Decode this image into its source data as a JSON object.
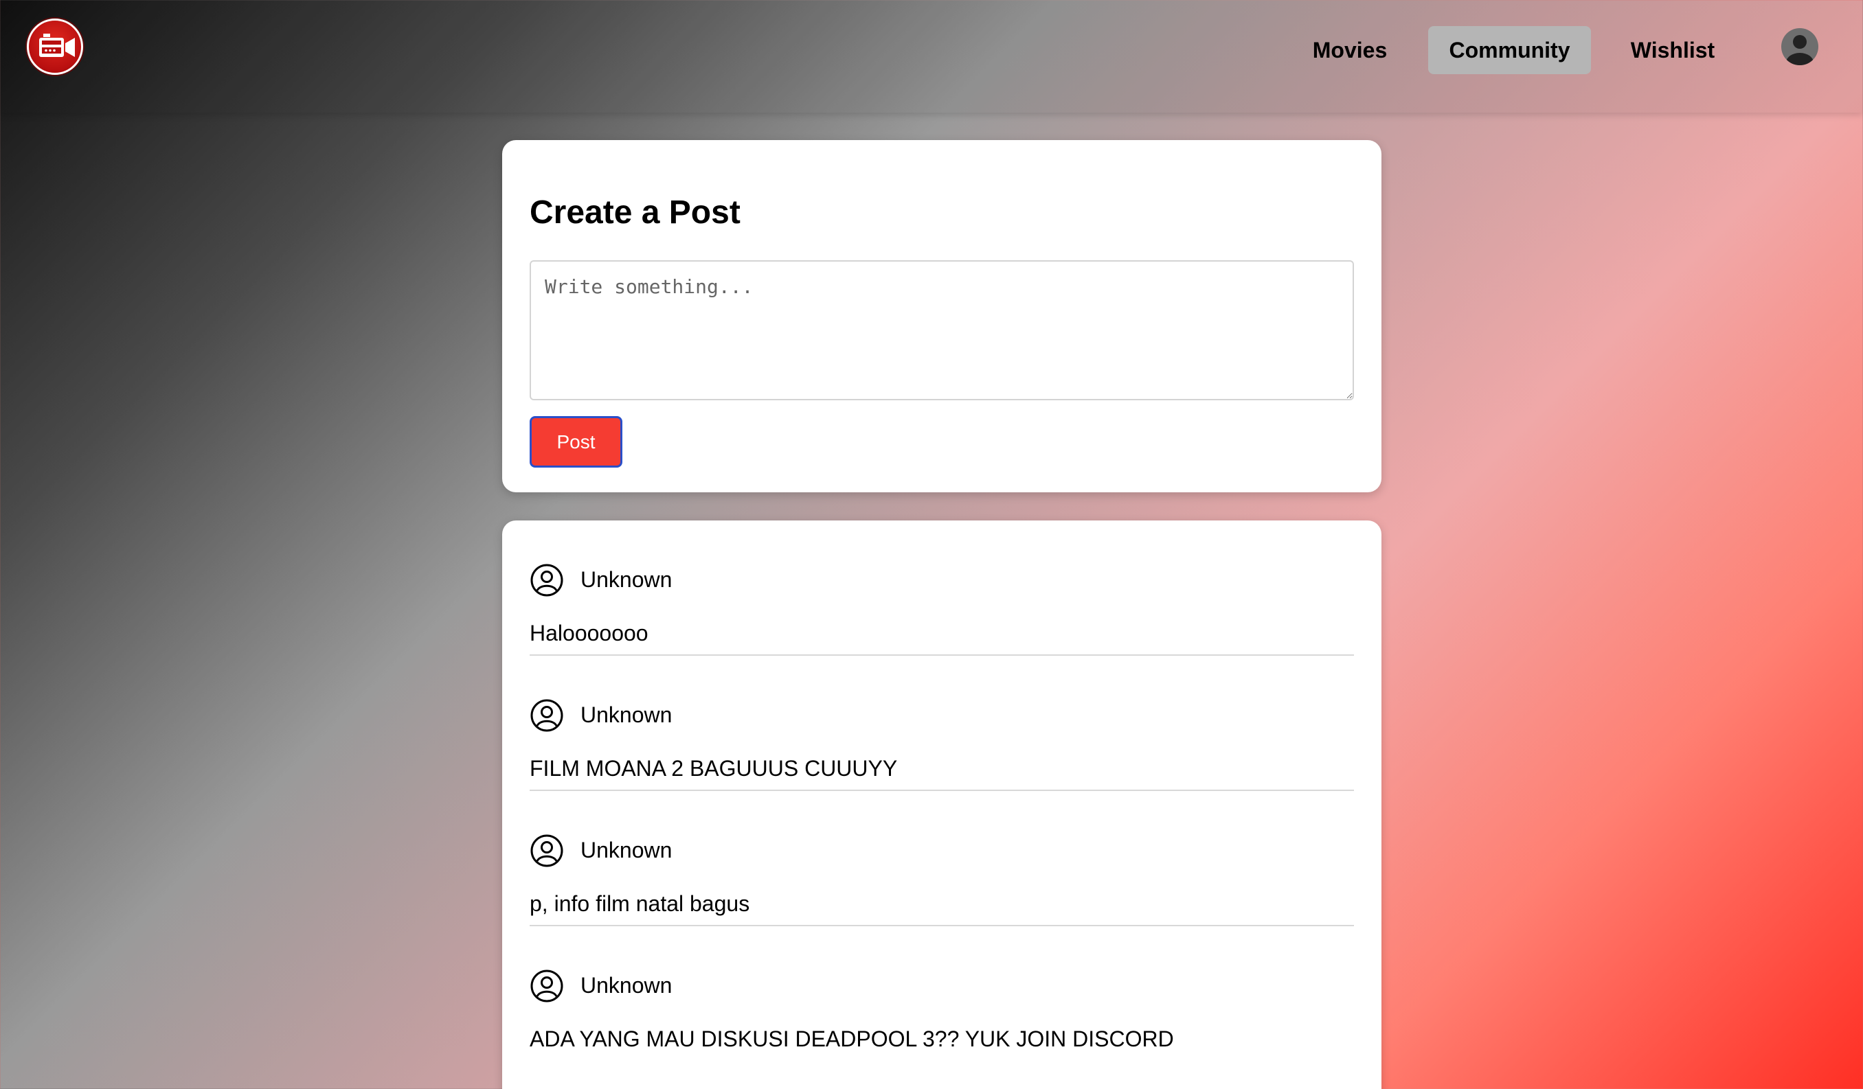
{
  "nav": {
    "logo_icon": "movie-camera-icon",
    "items": [
      {
        "label": "Movies",
        "active": false
      },
      {
        "label": "Community",
        "active": true
      },
      {
        "label": "Wishlist",
        "active": false
      }
    ],
    "avatar_icon": "user-avatar-icon"
  },
  "create_post": {
    "title": "Create a Post",
    "textarea_value": "",
    "textarea_placeholder": "Write something...",
    "post_button_label": "Post",
    "post_button_color": "#f53c32"
  },
  "feed": {
    "posts": [
      {
        "username": "Unknown",
        "text": "Halooooooo"
      },
      {
        "username": "Unknown",
        "text": "FILM MOANA 2 BAGUUUS CUUUYY"
      },
      {
        "username": "Unknown",
        "text": "p, info film natal bagus"
      },
      {
        "username": "Unknown",
        "text": "ADA YANG MAU DISKUSI DEADPOOL 3?? YUK JOIN DISCORD"
      }
    ]
  },
  "colors": {
    "active_tab_bg": "#b5b5b5",
    "gradient_dark": "#111111",
    "gradient_red": "#ff2f24"
  }
}
